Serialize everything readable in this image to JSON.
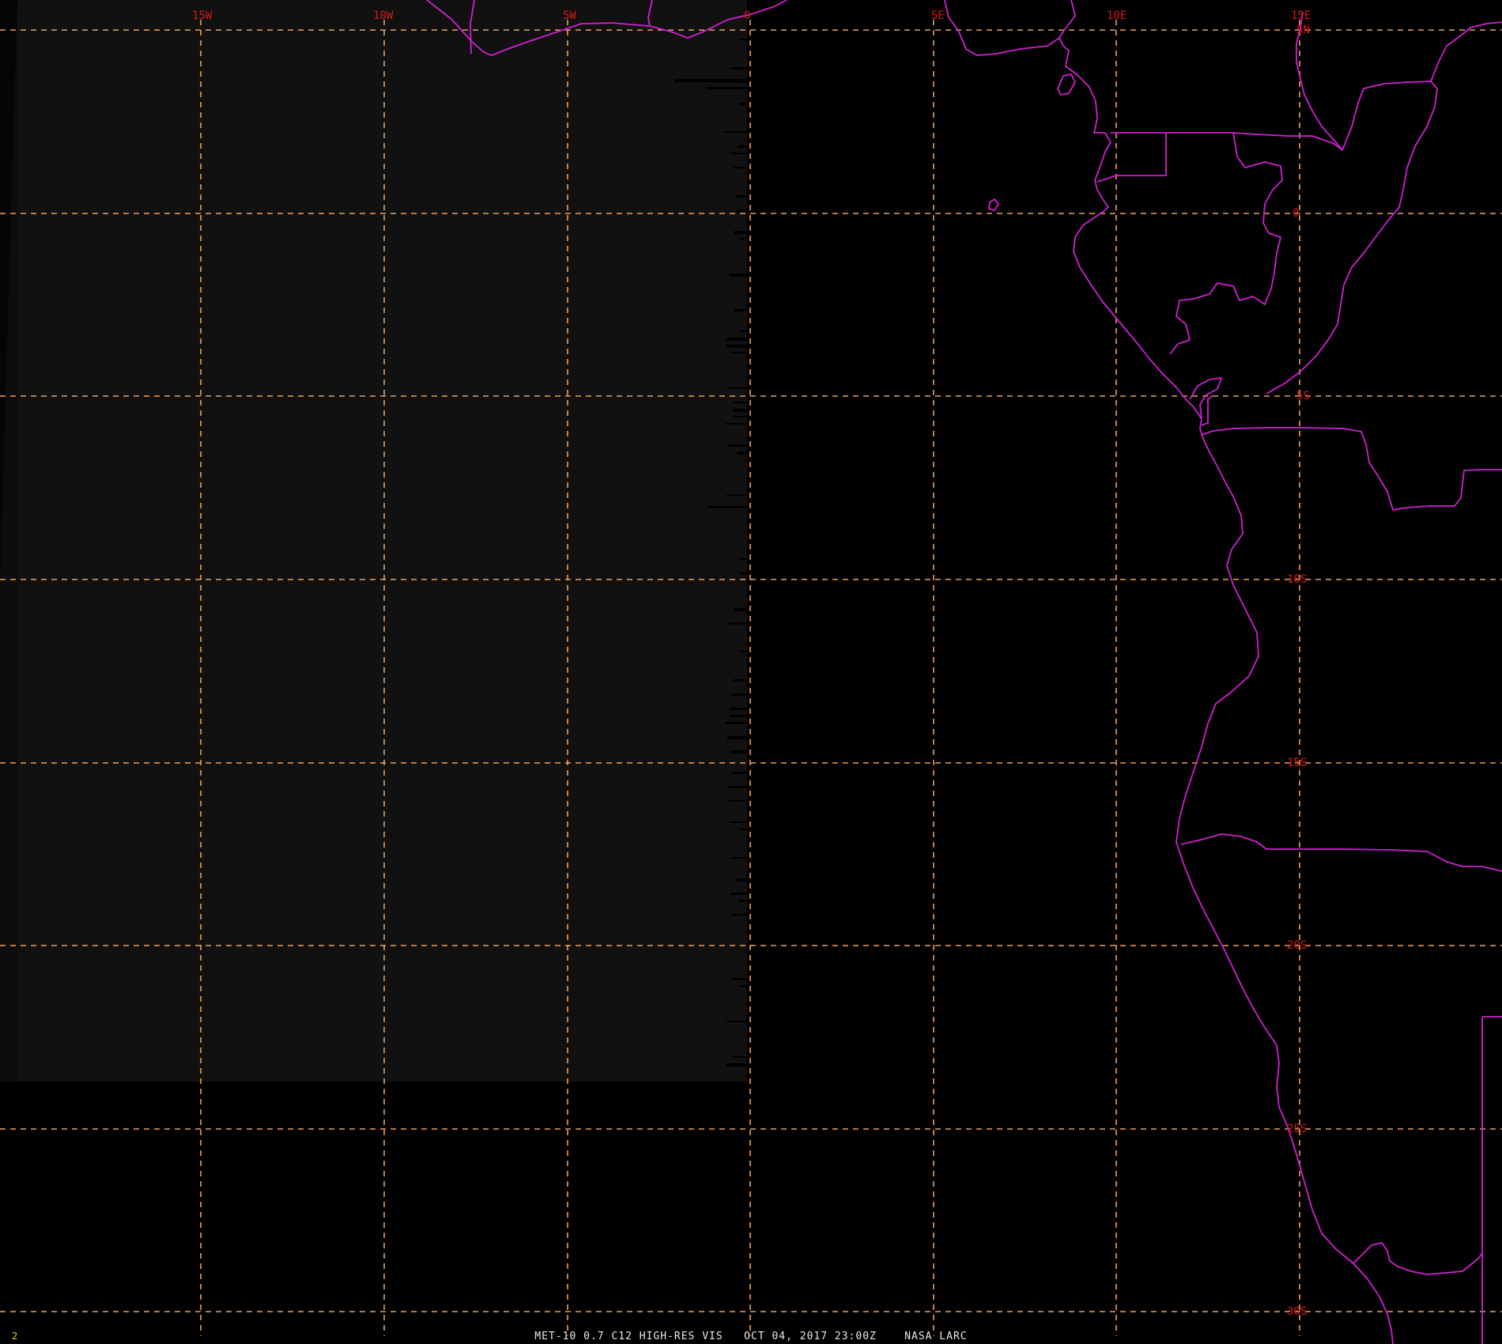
{
  "image": {
    "caption": "MET-10 0.7 C12 HIGH-RES VIS   OCT 04, 2017 23:00Z    NASA LARC",
    "frame_number": "2"
  },
  "grid": {
    "longitude_labels": [
      "15W",
      "10W",
      "5W",
      "0",
      "5E",
      "10E",
      "15E"
    ],
    "latitude_labels": [
      "5N",
      "0",
      "5S",
      "10S",
      "15S",
      "20S",
      "25S",
      "30S"
    ],
    "line_color": "#e8a060",
    "label_color": "#d81818"
  },
  "map": {
    "border_color": "#d020d0",
    "background_color": "#000000",
    "scan_region_color": "#111111"
  }
}
